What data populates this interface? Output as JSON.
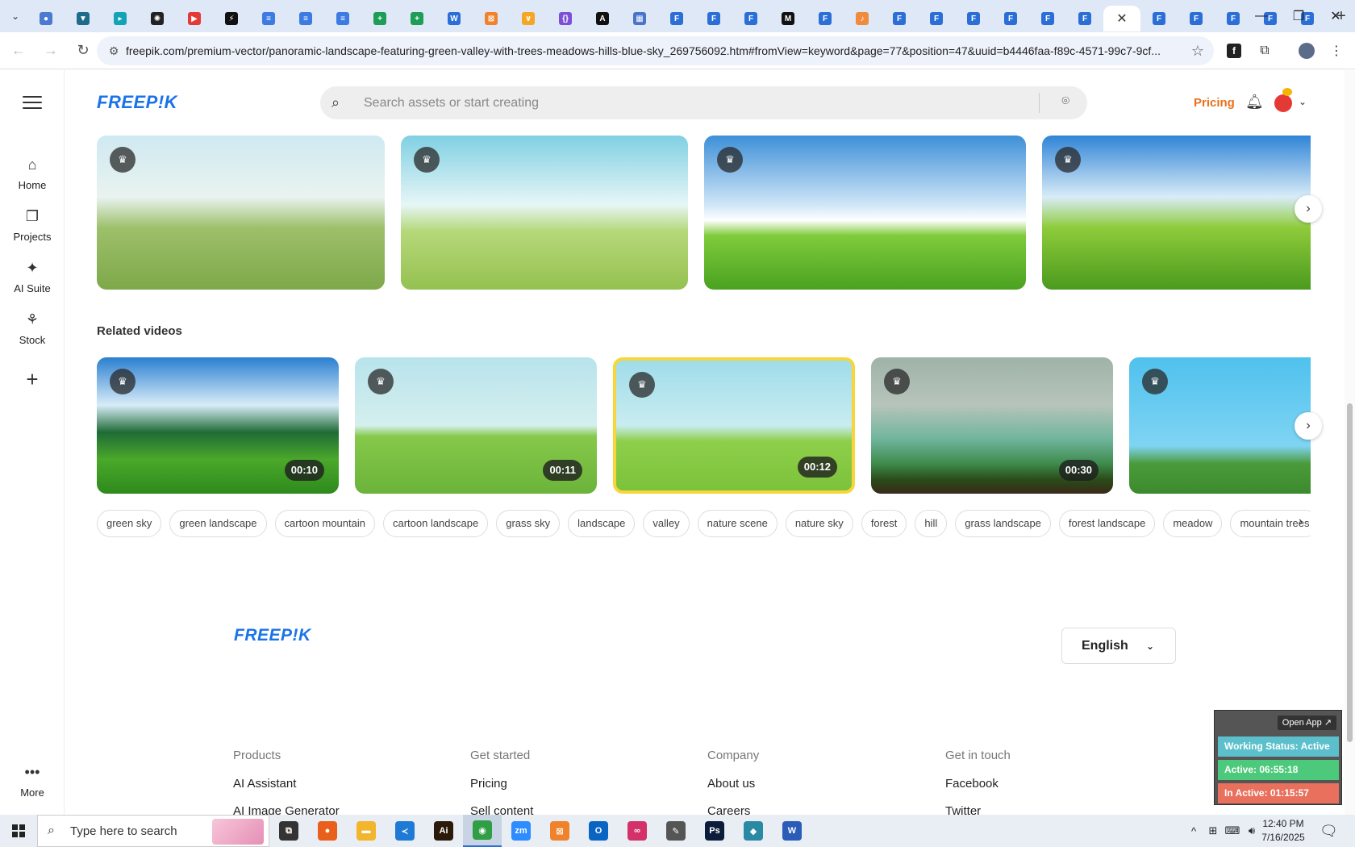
{
  "browser": {
    "tabs": [
      {
        "icon": "globe-tab-icon",
        "color": "#4a7bd0",
        "glyph": "●"
      },
      {
        "icon": "vpn-tab-icon",
        "color": "#1f6c8a",
        "glyph": "▼"
      },
      {
        "icon": "arrow-tab-icon",
        "color": "#12a3b5",
        "glyph": "▸"
      },
      {
        "icon": "openai-tab-icon",
        "color": "#222222",
        "glyph": "✺"
      },
      {
        "icon": "youtube-tab-icon",
        "color": "#e53935",
        "glyph": "▶"
      },
      {
        "icon": "bolt-tab-icon",
        "color": "#111111",
        "glyph": "⚡"
      },
      {
        "icon": "docs-tab-icon",
        "color": "#3d7be3",
        "glyph": "≡"
      },
      {
        "icon": "docs-tab-icon",
        "color": "#3d7be3",
        "glyph": "≡"
      },
      {
        "icon": "docs-tab-icon",
        "color": "#3d7be3",
        "glyph": "≡"
      },
      {
        "icon": "sheets-tab-icon",
        "color": "#1e9d57",
        "glyph": "+"
      },
      {
        "icon": "sheets-tab-icon",
        "color": "#1e9d57",
        "glyph": "+"
      },
      {
        "icon": "word-online-tab-icon",
        "color": "#2b6fd6",
        "glyph": "W"
      },
      {
        "icon": "xampp-tab-icon",
        "color": "#f0822b",
        "glyph": "⊠"
      },
      {
        "icon": "bird-tab-icon",
        "color": "#f5a623",
        "glyph": "∨"
      },
      {
        "icon": "json-tab-icon",
        "color": "#7b4fd6",
        "glyph": "{}"
      },
      {
        "icon": "a-tab-icon",
        "color": "#111111",
        "glyph": "A"
      },
      {
        "icon": "qr-tab-icon",
        "color": "#4a74c9",
        "glyph": "▦"
      },
      {
        "icon": "forms-tab-icon",
        "color": "#2b6fd6",
        "glyph": "F"
      },
      {
        "icon": "forms-tab-icon",
        "color": "#2b6fd6",
        "glyph": "F"
      },
      {
        "icon": "forms-tab-icon",
        "color": "#2b6fd6",
        "glyph": "F"
      },
      {
        "icon": "medium-tab-icon",
        "color": "#111111",
        "glyph": "M"
      },
      {
        "icon": "forms-tab-icon",
        "color": "#2b6fd6",
        "glyph": "F"
      },
      {
        "icon": "music-tab-icon",
        "color": "#f08a3c",
        "glyph": "♪"
      },
      {
        "icon": "forms-tab-icon",
        "color": "#2b6fd6",
        "glyph": "F"
      },
      {
        "icon": "forms-tab-icon",
        "color": "#2b6fd6",
        "glyph": "F"
      },
      {
        "icon": "forms-tab-icon",
        "color": "#2b6fd6",
        "glyph": "F"
      },
      {
        "icon": "forms-tab-icon",
        "color": "#2b6fd6",
        "glyph": "F"
      },
      {
        "icon": "forms-tab-icon",
        "color": "#2b6fd6",
        "glyph": "F"
      },
      {
        "icon": "forms-tab-icon",
        "color": "#2b6fd6",
        "glyph": "F"
      },
      {
        "icon": "close-icon",
        "color": "#ffffff",
        "glyph": "✕",
        "active": true
      },
      {
        "icon": "forms-tab-icon",
        "color": "#2b6fd6",
        "glyph": "F"
      },
      {
        "icon": "forms-tab-icon",
        "color": "#2b6fd6",
        "glyph": "F"
      },
      {
        "icon": "forms-tab-icon",
        "color": "#2b6fd6",
        "glyph": "F"
      },
      {
        "icon": "forms-tab-icon",
        "color": "#2b6fd6",
        "glyph": "F"
      },
      {
        "icon": "forms-tab-icon",
        "color": "#2b6fd6",
        "glyph": "F"
      }
    ],
    "new_tab": "+",
    "url": "freepik.com/premium-vector/panoramic-landscape-featuring-green-valley-with-trees-meadows-hills-blue-sky_269756092.htm#fromView=keyword&page=77&position=47&uuid=b4446faa-f89c-4571-99c7-9cf..."
  },
  "freepik": {
    "logo": "FREEP!K",
    "search_placeholder": "Search assets or start creating",
    "pricing": "Pricing",
    "rail": [
      {
        "icon": "home-icon",
        "glyph": "⌂",
        "label": "Home"
      },
      {
        "icon": "projects-icon",
        "glyph": "❐",
        "label": "Projects"
      },
      {
        "icon": "ai-suite-icon",
        "glyph": "✦",
        "label": "AI Suite"
      },
      {
        "icon": "stock-icon",
        "glyph": "⚘",
        "label": "Stock"
      }
    ],
    "more_label": "More",
    "related_videos_title": "Related videos",
    "videos": [
      {
        "duration": "00:10"
      },
      {
        "duration": "00:11"
      },
      {
        "duration": "00:12"
      },
      {
        "duration": "00:30"
      },
      {
        "duration": ""
      }
    ],
    "tags": [
      "green sky",
      "green landscape",
      "cartoon mountain",
      "cartoon landscape",
      "grass sky",
      "landscape",
      "valley",
      "nature scene",
      "nature sky",
      "forest",
      "hill",
      "grass landscape",
      "forest landscape",
      "meadow",
      "mountain trees"
    ],
    "footer": {
      "language": "English",
      "columns": [
        {
          "head": "Products",
          "links": [
            "AI Assistant",
            "AI Image Generator"
          ]
        },
        {
          "head": "Get started",
          "links": [
            "Pricing",
            "Sell content"
          ]
        },
        {
          "head": "Company",
          "links": [
            "About us",
            "Careers"
          ]
        },
        {
          "head": "Get in touch",
          "links": [
            "Facebook",
            "Twitter"
          ]
        }
      ]
    }
  },
  "tracker": {
    "open_app": "Open App ↗",
    "working_status": "Working Status: Active",
    "active": "Active: 06:55:18",
    "inactive": "In Active: 01:15:57",
    "colors": {
      "status": "#5bc0cc",
      "active": "#4cc97a",
      "inactive": "#e8705c"
    }
  },
  "taskbar": {
    "search_text": "Type here to search",
    "apps": [
      {
        "icon": "task-view-icon",
        "color": "#333333",
        "glyph": "⧉"
      },
      {
        "icon": "firefox-icon",
        "color": "#e8601c",
        "glyph": "●"
      },
      {
        "icon": "file-explorer-icon",
        "color": "#f2b52b",
        "glyph": "▬"
      },
      {
        "icon": "vscode-icon",
        "color": "#1f7ad6",
        "glyph": "≺"
      },
      {
        "icon": "illustrator-icon",
        "color": "#2b1a0a",
        "glyph": "Ai"
      },
      {
        "icon": "chrome-icon",
        "color": "#2f9e44",
        "glyph": "◉",
        "active": true
      },
      {
        "icon": "zoom-icon",
        "color": "#2d8cff",
        "glyph": "zm"
      },
      {
        "icon": "xampp-icon",
        "color": "#f0822b",
        "glyph": "⊠"
      },
      {
        "icon": "outlook-icon",
        "color": "#0a64c2",
        "glyph": "O"
      },
      {
        "icon": "creative-cloud-icon",
        "color": "#d4306a",
        "glyph": "∞"
      },
      {
        "icon": "pen-tool-icon",
        "color": "#555555",
        "glyph": "✎"
      },
      {
        "icon": "photoshop-icon",
        "color": "#0b1d3a",
        "glyph": "Ps"
      },
      {
        "icon": "diamond-app-icon",
        "color": "#2a8aa3",
        "glyph": "◆"
      },
      {
        "icon": "word-icon",
        "color": "#2b5cb8",
        "glyph": "W"
      }
    ],
    "time": "12:40 PM",
    "date": "7/16/2025"
  }
}
